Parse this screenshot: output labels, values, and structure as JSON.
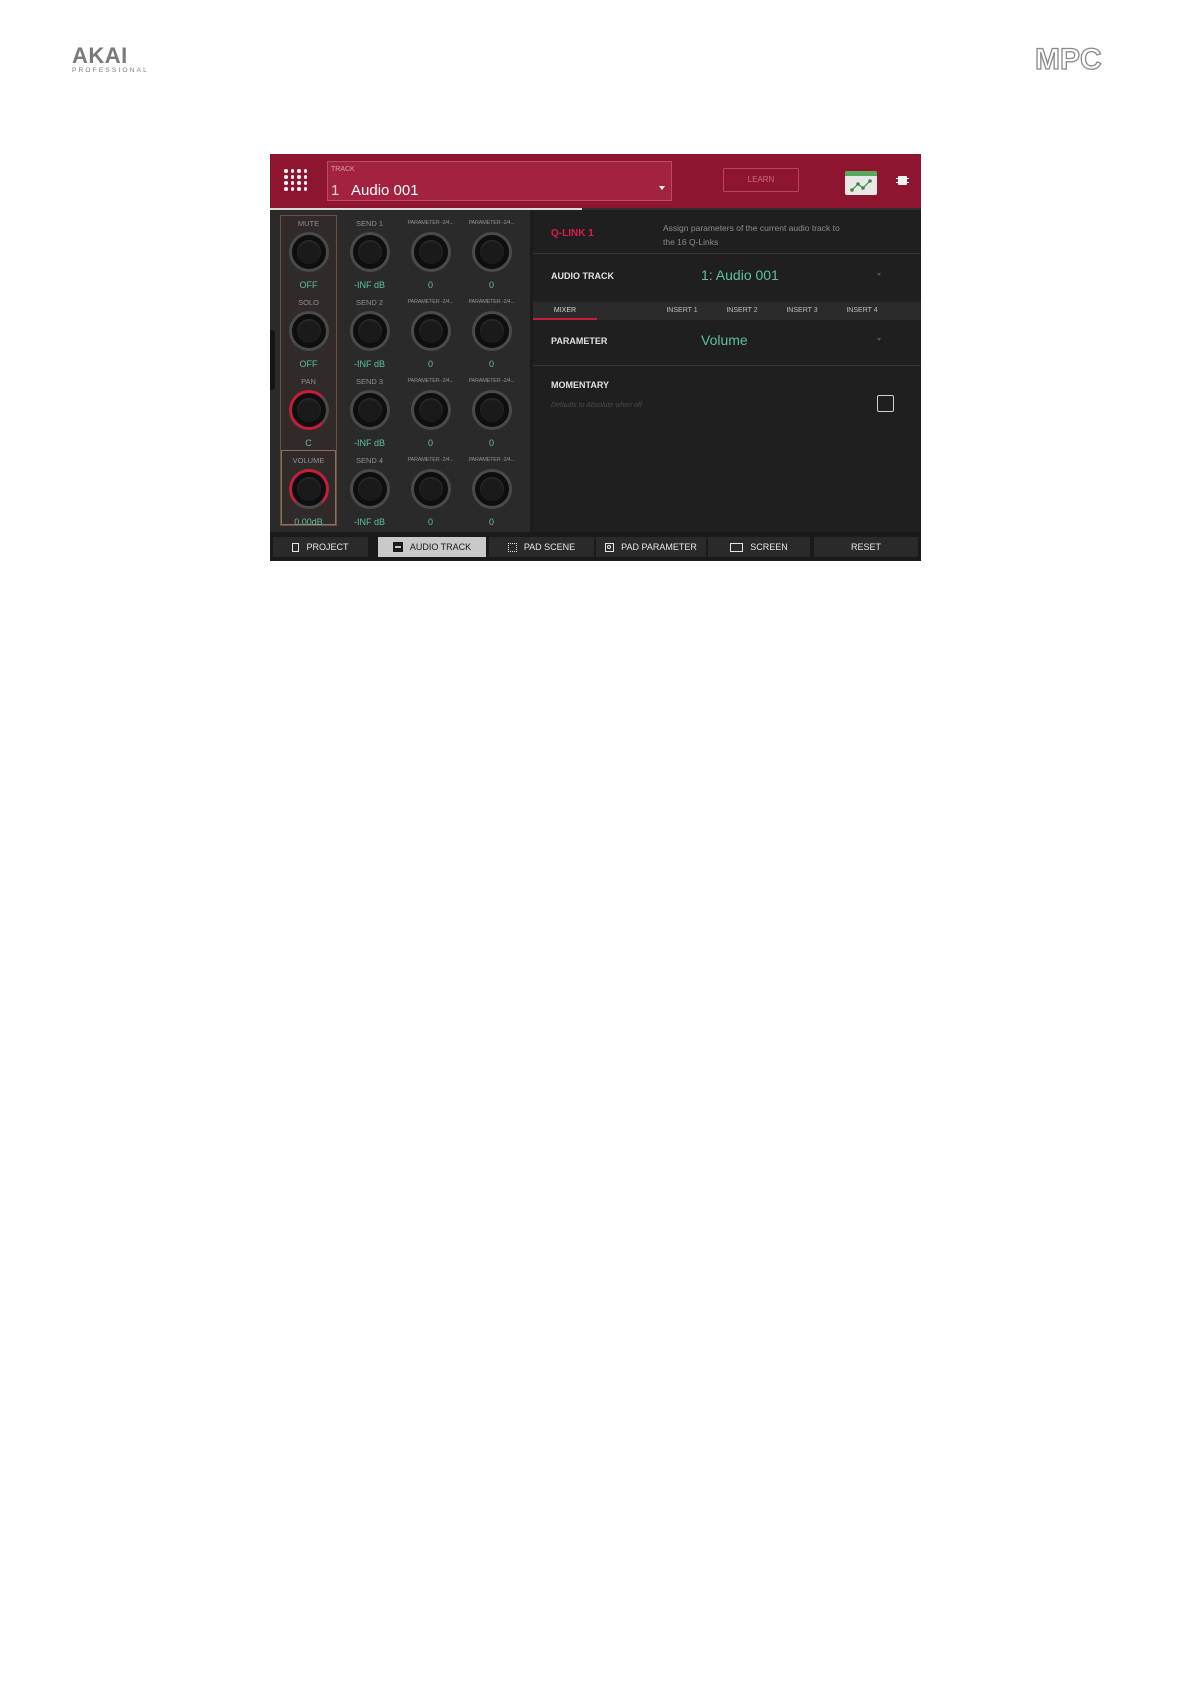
{
  "brand": {
    "left": "AKAI",
    "left_sub": "PROFESSIONAL",
    "right": "MPC"
  },
  "header": {
    "track_label": "TRACK",
    "track_number": "1",
    "track_name": "Audio 001",
    "learn_label": "LEARN",
    "progress": 0.48
  },
  "knobs": [
    [
      {
        "label": "MUTE",
        "value": "OFF",
        "style": "gray"
      },
      {
        "label": "SEND 1",
        "value": "-INF dB",
        "style": "gray"
      },
      {
        "label": "PARAMETER -2/4...",
        "value": "0",
        "style": "gray",
        "small": true
      },
      {
        "label": "PARAMETER -2/4...",
        "value": "0",
        "style": "gray",
        "small": true
      }
    ],
    [
      {
        "label": "SOLO",
        "value": "OFF",
        "style": "gray"
      },
      {
        "label": "SEND 2",
        "value": "-INF dB",
        "style": "gray"
      },
      {
        "label": "PARAMETER -2/4...",
        "value": "0",
        "style": "gray",
        "small": true
      },
      {
        "label": "PARAMETER -2/4...",
        "value": "0",
        "style": "gray",
        "small": true
      }
    ],
    [
      {
        "label": "PAN",
        "value": "C",
        "style": "red"
      },
      {
        "label": "SEND 3",
        "value": "-INF dB",
        "style": "gray"
      },
      {
        "label": "PARAMETER -2/4...",
        "value": "0",
        "style": "gray",
        "small": true
      },
      {
        "label": "PARAMETER -2/4...",
        "value": "0",
        "style": "gray",
        "small": true
      }
    ],
    [
      {
        "label": "VOLUME",
        "value": "0.00dB",
        "style": "red-full"
      },
      {
        "label": "SEND 4",
        "value": "-INF dB",
        "style": "gray"
      },
      {
        "label": "PARAMETER -2/4...",
        "value": "0",
        "style": "gray",
        "small": true
      },
      {
        "label": "PARAMETER -2/4...",
        "value": "0",
        "style": "gray",
        "small": true
      }
    ]
  ],
  "panel": {
    "qlink_title": "Q-LINK 1",
    "description": "Assign parameters of the current audio track to the 16 Q-Links",
    "audio_track_label": "AUDIO TRACK",
    "audio_track_value": "1: Audio 001",
    "tabs": [
      "MIXER",
      "INSERT 1",
      "INSERT 2",
      "INSERT 3",
      "INSERT 4"
    ],
    "active_tab": "MIXER",
    "parameter_label": "PARAMETER",
    "parameter_value": "Volume",
    "momentary_label": "MOMENTARY",
    "momentary_sub": "Defaults to Absolute when off",
    "momentary_checked": false
  },
  "bottom_bar": {
    "buttons": [
      {
        "label": "PROJECT",
        "icon": "document-icon"
      },
      {
        "label": "AUDIO TRACK",
        "icon": "audio-track-icon",
        "active": true
      },
      {
        "label": "PAD SCENE",
        "icon": "pad-grid-icon"
      },
      {
        "label": "PAD PARAMETER",
        "icon": "pad-icon"
      },
      {
        "label": "SCREEN",
        "icon": "screen-icon"
      }
    ],
    "reset_label": "RESET"
  },
  "colors": {
    "header_bg": "#8e1530",
    "accent_red": "#c41e3a",
    "value_green": "#5ec0a4",
    "panel_bg": "#1f1f1f"
  }
}
